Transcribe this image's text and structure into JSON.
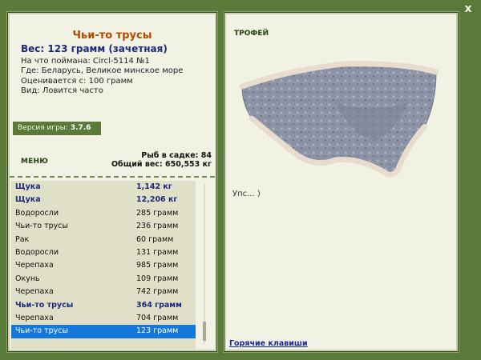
{
  "window": {
    "close_label": "x"
  },
  "fish": {
    "title": "Чьи-то трусы",
    "weight": "Вес: 123 грамм (зачетная)",
    "bait": "На что поймана: Circl-5114 №1",
    "where": "Где: Беларусь, Великое минское море",
    "value": "Оценивается с: 100 грамм",
    "kind": "Вид: Ловится часто"
  },
  "version": {
    "label": "Версия игры:",
    "number": "3.7.6"
  },
  "menu": {
    "label": "МЕНЮ"
  },
  "stats": {
    "count": "Рыб в садке: 84",
    "total": "Общий вес: 650,553 кг"
  },
  "catch_list": [
    {
      "name": "Щука",
      "weight": "1,142 кг",
      "trophy": true,
      "selected": false
    },
    {
      "name": "Щука",
      "weight": "12,206 кг",
      "trophy": true,
      "selected": false
    },
    {
      "name": "Водоросли",
      "weight": "285 грамм",
      "trophy": false,
      "selected": false
    },
    {
      "name": "Чьи-то трусы",
      "weight": "236 грамм",
      "trophy": false,
      "selected": false
    },
    {
      "name": "Рак",
      "weight": "60 грамм",
      "trophy": false,
      "selected": false
    },
    {
      "name": "Водоросли",
      "weight": "131 грамм",
      "trophy": false,
      "selected": false
    },
    {
      "name": "Черепаха",
      "weight": "985 грамм",
      "trophy": false,
      "selected": false
    },
    {
      "name": "Окунь",
      "weight": "109 грамм",
      "trophy": false,
      "selected": false
    },
    {
      "name": "Черепаха",
      "weight": "742 грамм",
      "trophy": false,
      "selected": false
    },
    {
      "name": "Чьи-то трусы",
      "weight": "364 грамм",
      "trophy": true,
      "selected": false
    },
    {
      "name": "Черепаха",
      "weight": "704 грамм",
      "trophy": false,
      "selected": false
    },
    {
      "name": "Чьи-то трусы",
      "weight": "123 грамм",
      "trophy": false,
      "selected": true
    }
  ],
  "trophy": {
    "label": "ТРОФЕЙ",
    "comment": "Упс... )"
  },
  "footer": {
    "hotkeys_label": "Горячие клавиши"
  },
  "colors": {
    "frame": "#5a7a3a",
    "panel": "#f2f2e4",
    "title": "#b24a00",
    "trophy_text": "#1a2a7a",
    "selection": "#1478d8"
  }
}
